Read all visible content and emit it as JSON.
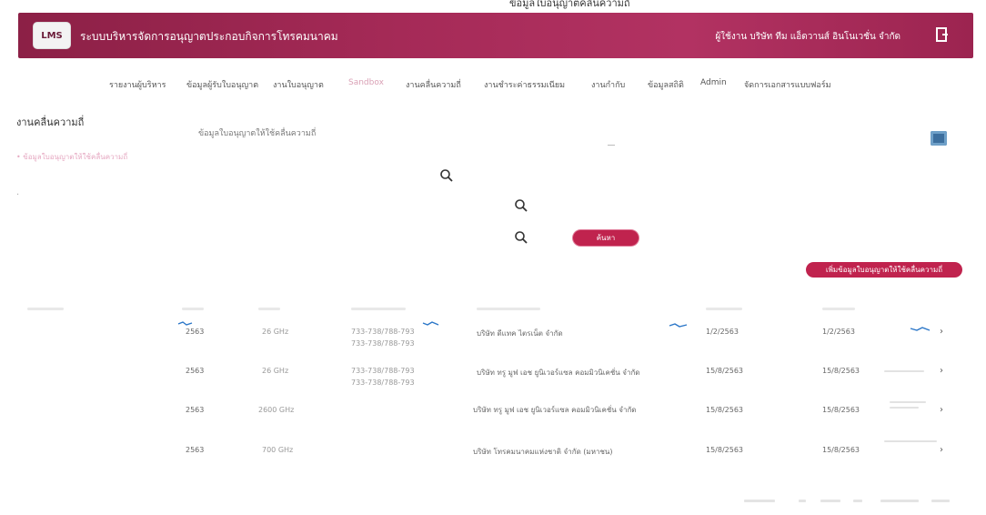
{
  "page_heading": "ข้อมูลใบอนุญาตคลื่นความถี่",
  "header": {
    "logo_text": "LMS",
    "app_title": "ระบบบริหารจัดการอนุญาตประกอบกิจการโทรคมนาคม",
    "user_text": "ผู้ใช้งาน บริษัท ทีม แอ็ดวานส์ อินโนเวชั่น จำกัด",
    "logout_icon": "logout-icon"
  },
  "nav": {
    "items": [
      {
        "label": "รายงานผู้บริหาร"
      },
      {
        "label": "ข้อมูลผู้รับใบอนุญาต"
      },
      {
        "label": "งานใบอนุญาต"
      },
      {
        "label": "Sandbox"
      },
      {
        "label": "งานคลื่นความถี่"
      },
      {
        "label": "งานชำระค่าธรรมเนียม"
      },
      {
        "label": "งานกำกับ"
      },
      {
        "label": "ข้อมูลสถิติ"
      },
      {
        "label": "Admin"
      },
      {
        "label": "จัดการเอกสารแบบฟอร์ม"
      }
    ],
    "active_index": 3,
    "active_color": "#d9a0b5"
  },
  "main": {
    "section_title": "งานคลื่นความถี่",
    "subtitle": "ข้อมูลใบอนุญาตให้ใช้คลื่นความถี่",
    "side_link": "• ข้อมูลใบอนุญาตให้ใช้คลื่นความถี่",
    "search_button": "ค้นหา",
    "add_button": "เพิ่มข้อมูลใบอนุญาตให้ใช้คลื่นความถี่",
    "accent_color": "#c0234e"
  },
  "table": {
    "rows": [
      {
        "year": "2563",
        "band": "26 GHz",
        "range1": "733-738/788-793",
        "range2": "733-738/788-793",
        "company": "บริษัท ดีแทค ไตรเน็ต จำกัด",
        "date1": "1/2/2563",
        "date2": "1/2/2563"
      },
      {
        "year": "2563",
        "band": "26 GHz",
        "range1": "733-738/788-793",
        "range2": "733-738/788-793",
        "company": "บริษัท ทรู มูฟ เอช ยูนิเวอร์แซล คอมมิวนิเคชั่น จำกัด",
        "date1": "15/8/2563",
        "date2": "15/8/2563"
      },
      {
        "year": "2563",
        "band": "2600 GHz",
        "range1": "",
        "range2": "",
        "company": "บริษัท ทรู มูฟ เอช ยูนิเวอร์แซล คอมมิวนิเคชั่น จำกัด",
        "date1": "15/8/2563",
        "date2": "15/8/2563"
      },
      {
        "year": "2563",
        "band": "700 GHz",
        "range1": "",
        "range2": "",
        "company": "บริษัท โทรคมนาคมแห่งชาติ จำกัด (มหาชน)",
        "date1": "15/8/2563",
        "date2": "15/8/2563"
      }
    ]
  }
}
